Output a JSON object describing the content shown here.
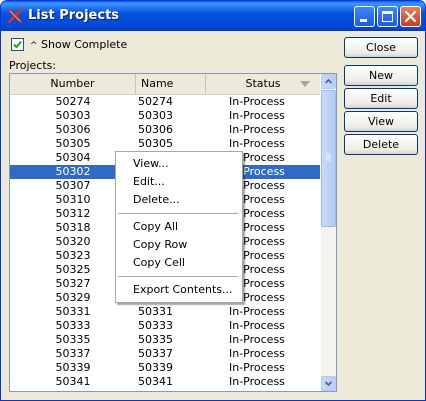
{
  "window": {
    "title": "List Projects"
  },
  "options": {
    "show_complete_label": "Show Complete",
    "show_complete_checked": true
  },
  "projects_label": "Projects:",
  "table": {
    "columns": [
      "Number",
      "Name",
      "Status"
    ],
    "rows": [
      [
        "50274",
        "50274",
        "In-Process"
      ],
      [
        "50303",
        "50303",
        "In-Process"
      ],
      [
        "50306",
        "50306",
        "In-Process"
      ],
      [
        "50305",
        "50305",
        "In-Process"
      ],
      [
        "50304",
        "",
        "In-Process"
      ],
      [
        "50302",
        "",
        "In-Process"
      ],
      [
        "50307",
        "",
        "In-Process"
      ],
      [
        "50310",
        "",
        "In-Process"
      ],
      [
        "50312",
        "",
        "In-Process"
      ],
      [
        "50318",
        "",
        "In-Process"
      ],
      [
        "50320",
        "",
        "In-Process"
      ],
      [
        "50323",
        "",
        "In-Process"
      ],
      [
        "50325",
        "",
        "In-Process"
      ],
      [
        "50327",
        "",
        "In-Process"
      ],
      [
        "50329",
        "",
        "In-Process"
      ],
      [
        "50331",
        "50331",
        "In-Process"
      ],
      [
        "50333",
        "50333",
        "In-Process"
      ],
      [
        "50335",
        "50335",
        "In-Process"
      ],
      [
        "50337",
        "50337",
        "In-Process"
      ],
      [
        "50339",
        "50339",
        "In-Process"
      ],
      [
        "50341",
        "50341",
        "In-Process"
      ]
    ],
    "selected_row": 5
  },
  "buttons": {
    "close": "Close",
    "new": "New",
    "edit": "Edit",
    "view": "View",
    "delete": "Delete"
  },
  "context_menu": {
    "view": "View...",
    "edit": "Edit...",
    "delete": "Delete...",
    "copy_all": "Copy All",
    "copy_row": "Copy Row",
    "copy_cell": "Copy Cell",
    "export": "Export Contents..."
  },
  "colors": {
    "title_bar": "#0553e1",
    "selection": "#316ac5",
    "close_button": "#c4401c"
  }
}
